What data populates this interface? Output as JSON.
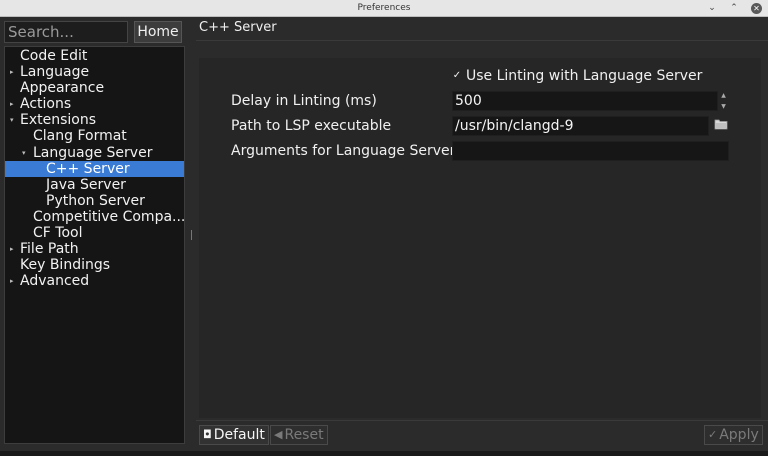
{
  "window": {
    "title": "Preferences"
  },
  "search": {
    "placeholder": "Search..."
  },
  "home_button": {
    "label": "Home"
  },
  "tree": {
    "items": [
      {
        "label": "Code Edit",
        "depth": 0,
        "arrow": ""
      },
      {
        "label": "Language",
        "depth": 0,
        "arrow": "▸"
      },
      {
        "label": "Appearance",
        "depth": 0,
        "arrow": ""
      },
      {
        "label": "Actions",
        "depth": 0,
        "arrow": "▸"
      },
      {
        "label": "Extensions",
        "depth": 0,
        "arrow": "▾"
      },
      {
        "label": "Clang Format",
        "depth": 1,
        "arrow": ""
      },
      {
        "label": "Language Server",
        "depth": 1,
        "arrow": "▾"
      },
      {
        "label": "C++ Server",
        "depth": 2,
        "arrow": "",
        "selected": true
      },
      {
        "label": "Java Server",
        "depth": 2,
        "arrow": ""
      },
      {
        "label": "Python Server",
        "depth": 2,
        "arrow": ""
      },
      {
        "label": "Competitive Compa...",
        "depth": 1,
        "arrow": ""
      },
      {
        "label": "CF Tool",
        "depth": 1,
        "arrow": ""
      },
      {
        "label": "File Path",
        "depth": 0,
        "arrow": "▸"
      },
      {
        "label": "Key Bindings",
        "depth": 0,
        "arrow": ""
      },
      {
        "label": "Advanced",
        "depth": 0,
        "arrow": "▸"
      }
    ]
  },
  "section": {
    "title": "C++ Server"
  },
  "settings": {
    "use_linting": {
      "label": "Use Linting with Language Server",
      "checked": true,
      "check_glyph": "✓"
    },
    "delay": {
      "label": "Delay in Linting (ms)",
      "value": "500"
    },
    "lsp_path": {
      "label": "Path to LSP executable",
      "value": "/usr/bin/clangd-9"
    },
    "arguments": {
      "label": "Arguments for Language Server",
      "value": ""
    }
  },
  "buttons": {
    "default": {
      "label": "Default",
      "icon": "◘"
    },
    "reset": {
      "label": "Reset",
      "icon": "◀"
    },
    "apply": {
      "label": "Apply",
      "icon": "✓"
    }
  },
  "window_controls": {
    "minimize": "⌄",
    "maximize": "⌃",
    "close": "✕"
  }
}
